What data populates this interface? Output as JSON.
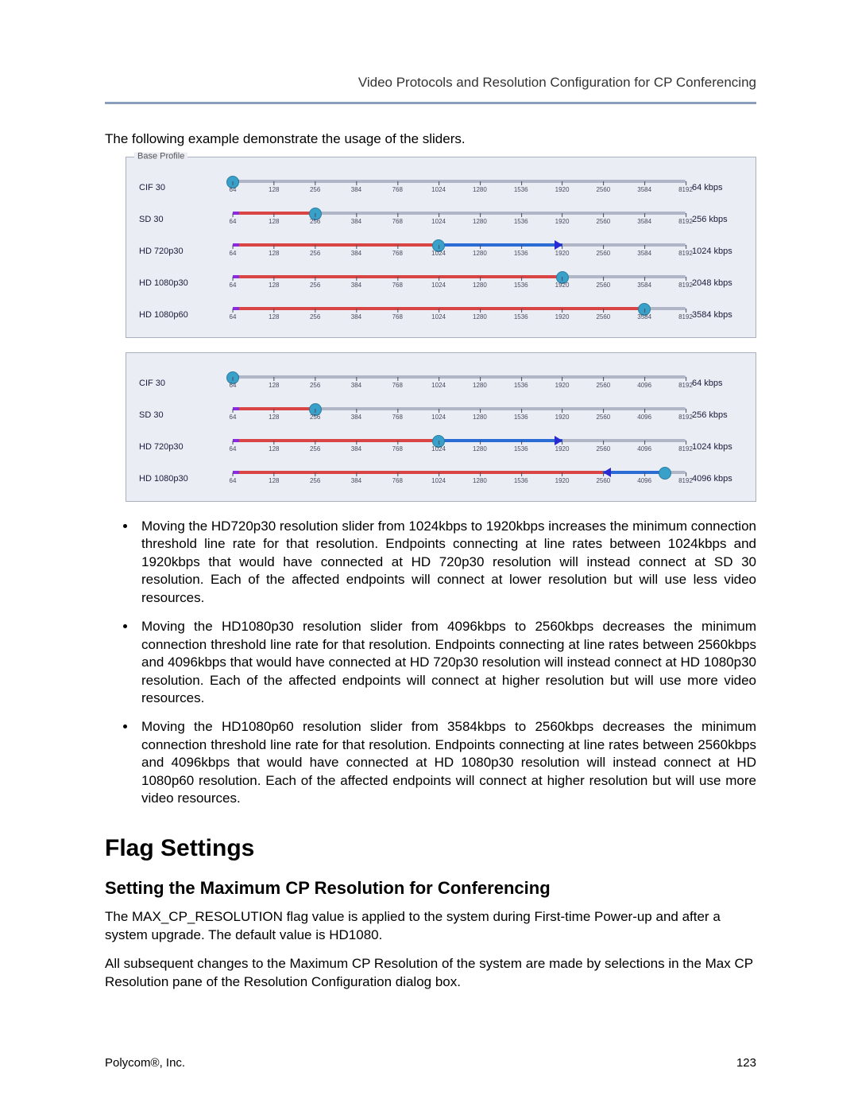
{
  "header": {
    "title": "Video Protocols and Resolution Configuration for CP Conferencing"
  },
  "intro": "The following example demonstrate the usage of the sliders.",
  "ticks1": [
    "64",
    "128",
    "256",
    "384",
    "768",
    "1024",
    "1280",
    "1536",
    "1920",
    "2560",
    "3584",
    "8192"
  ],
  "ticks2": [
    "64",
    "128",
    "256",
    "384",
    "768",
    "1024",
    "1280",
    "1536",
    "1920",
    "2560",
    "4096",
    "8192"
  ],
  "panel1_label": "Base Profile",
  "panel1": [
    {
      "name": "CIF 30",
      "value": "64 kbps",
      "thumb": 0,
      "pre_to": 0
    },
    {
      "name": "SD 30",
      "value": "256 kbps",
      "thumb": 2,
      "pre_to": 2
    },
    {
      "name": "HD 720p30",
      "value": "1024 kbps",
      "thumb": 5,
      "pre_to": 5,
      "blue_from": 5,
      "blue_to": 8,
      "arrow_at": 8,
      "arrow_dir": "right"
    },
    {
      "name": "HD 1080p30",
      "value": "2048 kbps",
      "thumb": 8,
      "pre_to": 8
    },
    {
      "name": "HD 1080p60",
      "value": "3584 kbps",
      "thumb": 10,
      "pre_to": 10
    }
  ],
  "panel2": [
    {
      "name": "CIF 30",
      "value": "64 kbps",
      "thumb": 0,
      "pre_to": 0
    },
    {
      "name": "SD 30",
      "value": "256 kbps",
      "thumb": 2,
      "pre_to": 2
    },
    {
      "name": "HD 720p30",
      "value": "1024 kbps",
      "thumb": 5,
      "pre_to": 5,
      "blue_from": 5,
      "blue_to": 8,
      "arrow_at": 8,
      "arrow_dir": "right"
    },
    {
      "name": "HD 1080p30",
      "value": "4096 kbps",
      "thumb": 10.5,
      "pre_to": 10.5,
      "blue_from": 9,
      "blue_to": 10.5,
      "arrow_at": 9,
      "arrow_dir": "left"
    }
  ],
  "bullets": [
    "Moving the HD720p30 resolution slider from 1024kbps to 1920kbps increases the minimum connection threshold line rate for that resolution. Endpoints connecting at line rates between 1024kbps and 1920kbps that would have connected at HD 720p30 resolution will instead connect at SD 30 resolution. Each of the affected endpoints will connect at lower resolution but will use less video resources.",
    "Moving the HD1080p30 resolution slider from 4096kbps to 2560kbps decreases the minimum connection threshold line rate for that resolution. Endpoints connecting at line rates between 2560kbps and 4096kbps that would have connected at HD 720p30 resolution will instead connect at HD 1080p30 resolution. Each of the affected endpoints will connect at higher resolution but will use more video resources.",
    "Moving the HD1080p60 resolution slider from 3584kbps to 2560kbps decreases the minimum connection threshold line rate for that resolution. Endpoints connecting at line rates between 2560kbps and 4096kbps that would have connected at HD 1080p30 resolution will instead connect at HD 1080p60 resolution. Each of the affected endpoints will connect at higher resolution but will use more video resources."
  ],
  "h2": "Flag Settings",
  "h3": "Setting the Maximum CP Resolution for Conferencing",
  "p1": "The MAX_CP_RESOLUTION flag value is applied to the system during First-time Power-up and after a system upgrade. The default value is HD1080.",
  "p2": "All subsequent changes to the Maximum CP Resolution of the system are made by selections in the Max CP Resolution pane of the Resolution Configuration dialog box.",
  "footer": {
    "left": "Polycom®, Inc.",
    "right": "123"
  }
}
